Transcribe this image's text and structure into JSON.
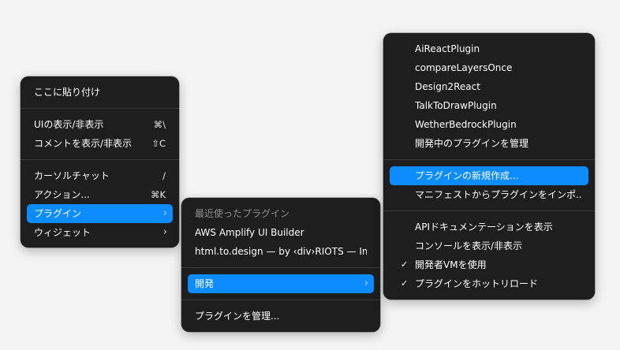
{
  "main_menu": {
    "paste_here": "ここに貼り付け",
    "toggle_ui": {
      "label": "UIの表示/非表示",
      "shortcut": "⌘\\"
    },
    "toggle_comments": {
      "label": "コメントを表示/非表示",
      "shortcut": "⇧C"
    },
    "cursor_chat": {
      "label": "カーソルチャット",
      "shortcut": "/"
    },
    "actions": {
      "label": "アクション...",
      "shortcut": "⌘K"
    },
    "plugins": {
      "label": "プラグイン",
      "chevron": "›"
    },
    "widgets": {
      "label": "ウィジェット",
      "chevron": "›"
    }
  },
  "plugins_menu": {
    "recent_header": "最近使ったプラグイン",
    "recent": [
      "AWS Amplify UI Builder",
      "html.to.design — by ‹div›RIOTS — Im..."
    ],
    "development": {
      "label": "開発",
      "chevron": "›"
    },
    "manage": "プラグインを管理..."
  },
  "dev_menu": {
    "plugins": [
      "AiReactPlugin",
      "compareLayersOnce",
      "Design2React",
      "TalkToDrawPlugin",
      "WetherBedrockPlugin"
    ],
    "manage_in_dev": "開発中のプラグインを管理",
    "new_plugin": "プラグインの新規作成...",
    "import_manifest": "マニフェストからプラグインをインポ...",
    "api_docs": "APIドキュメンテーションを表示",
    "toggle_console": "コンソールを表示/非表示",
    "use_dev_vm": {
      "label": "開発者VMを使用",
      "checked": "✓"
    },
    "hot_reload": {
      "label": "プラグインをホットリロード",
      "checked": "✓"
    }
  },
  "colors": {
    "menu_bg": "#1e1e1e",
    "highlight": "#0d8cff",
    "text": "#ffffff",
    "muted": "#8f8f8f"
  }
}
